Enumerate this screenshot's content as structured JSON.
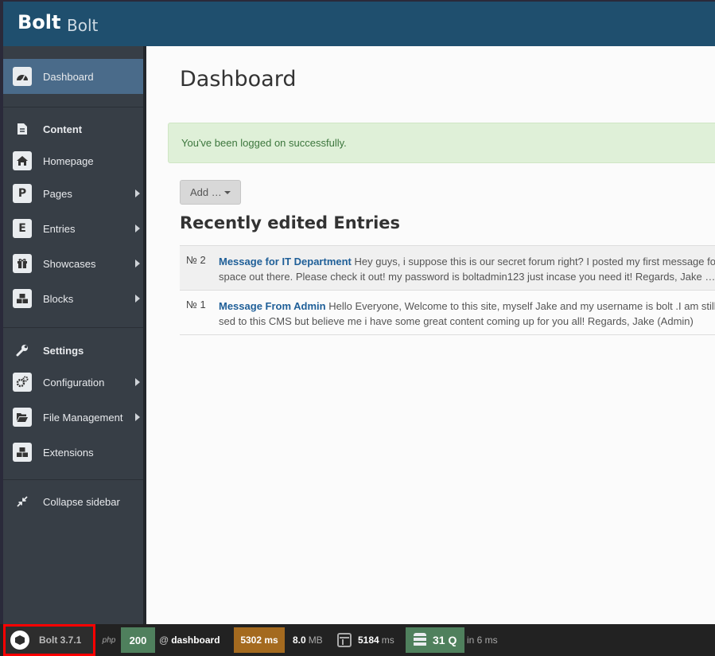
{
  "header": {
    "brand": "Bolt",
    "site_name": "Bolt"
  },
  "sidebar": {
    "dashboard": "Dashboard",
    "content_head": "Content",
    "homepage": "Homepage",
    "pages": {
      "letter": "P",
      "label": "Pages"
    },
    "entries": {
      "letter": "E",
      "label": "Entries"
    },
    "showcases": "Showcases",
    "blocks": "Blocks",
    "settings_head": "Settings",
    "configuration": "Configuration",
    "file_management": "File Management",
    "extensions": "Extensions",
    "collapse": "Collapse sidebar"
  },
  "main": {
    "title": "Dashboard",
    "alert": "You've been logged on successfully.",
    "add_button": "Add …",
    "recent_title": "Recently edited Entries",
    "entries": [
      {
        "num": "№ 2",
        "title": "Message for IT Department",
        "line1": "Hey guys, i suppose this is our secret forum right? I posted my first message fo",
        "line2": "space out there. Please check it out! my password is boltadmin123 just incase you need it! Regards, Jake …"
      },
      {
        "num": "№ 1",
        "title": "Message From Admin",
        "line1": "Hello Everyone, Welcome to this site, myself Jake and my username is bolt .I am still",
        "line2": "sed to this CMS but believe me i have some great content coming up for you all! Regards, Jake (Admin)"
      }
    ]
  },
  "debugbar": {
    "version": "Bolt 3.7.1",
    "php": "php",
    "status": "200",
    "route_prefix": "@",
    "route": "dashboard",
    "time": "5302 ms",
    "memory_value": "8.0",
    "memory_unit": "MB",
    "render_value": "5184",
    "render_unit": "ms",
    "queries": "31 Q",
    "query_time": "in 6 ms"
  }
}
